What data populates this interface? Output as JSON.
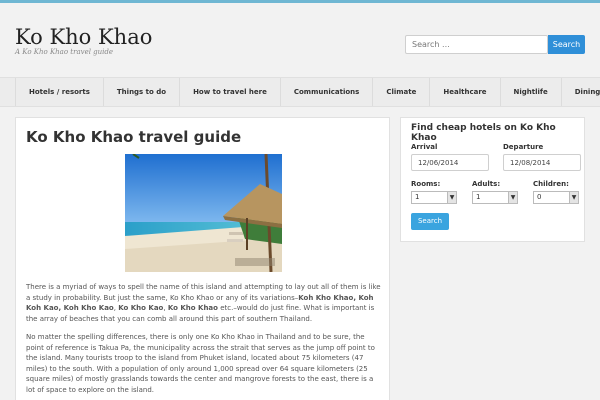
{
  "header": {
    "title": "Ko Kho Khao",
    "tagline": "A Ko Kho Khao travel guide",
    "search_placeholder": "Search ...",
    "search_button": "Search"
  },
  "nav": {
    "items": [
      "Hotels / resorts",
      "Things to do",
      "How to travel here",
      "Communications",
      "Climate",
      "Healthcare",
      "Nightlife",
      "Dining"
    ]
  },
  "main": {
    "title": "Ko Kho Khao travel guide",
    "para1_a": "There is a myriad of ways to spell the name of this island and attempting to lay out all of them is like a study in probability. But just the same, Ko Kho Khao or any of its variations–",
    "para1_b": "Koh Kho Khao, Koh Koh Kao, Koh Kho Kao",
    "para1_c": ", ",
    "para1_d": "Ko Kho Kao",
    "para1_e": ", ",
    "para1_f": "Ko Kho Khao",
    "para1_g": " etc.–would do just fine. What is important is the array of beaches that you can comb all around this part of southern Thailand.",
    "para2": "No matter the spelling differences, there is only one Ko Kho Khao in Thailand and to be sure, the point of reference is Takua Pa, the municipality across the strait that serves as the jump off point to the island. Many tourists troop to the island from Phuket island, located about 75 kilometers (47 miles) to the south. With a population of only around 1,000 spread over 64 square kilometers (25 square miles) of mostly grasslands towards the center and mangrove forests to the east, there is a lot of space to explore on the island."
  },
  "sidebar": {
    "title": "Find cheap hotels on Ko Kho Khao",
    "arrival_label": "Arrival",
    "arrival_value": "12/06/2014",
    "departure_label": "Departure",
    "departure_value": "12/08/2014",
    "rooms_label": "Rooms:",
    "rooms_value": "1",
    "adults_label": "Adults:",
    "adults_value": "1",
    "children_label": "Children:",
    "children_value": "0",
    "search_button": "Search"
  },
  "colors": {
    "accent": "#2f8fd8",
    "topbar": "#6fb7d3"
  }
}
